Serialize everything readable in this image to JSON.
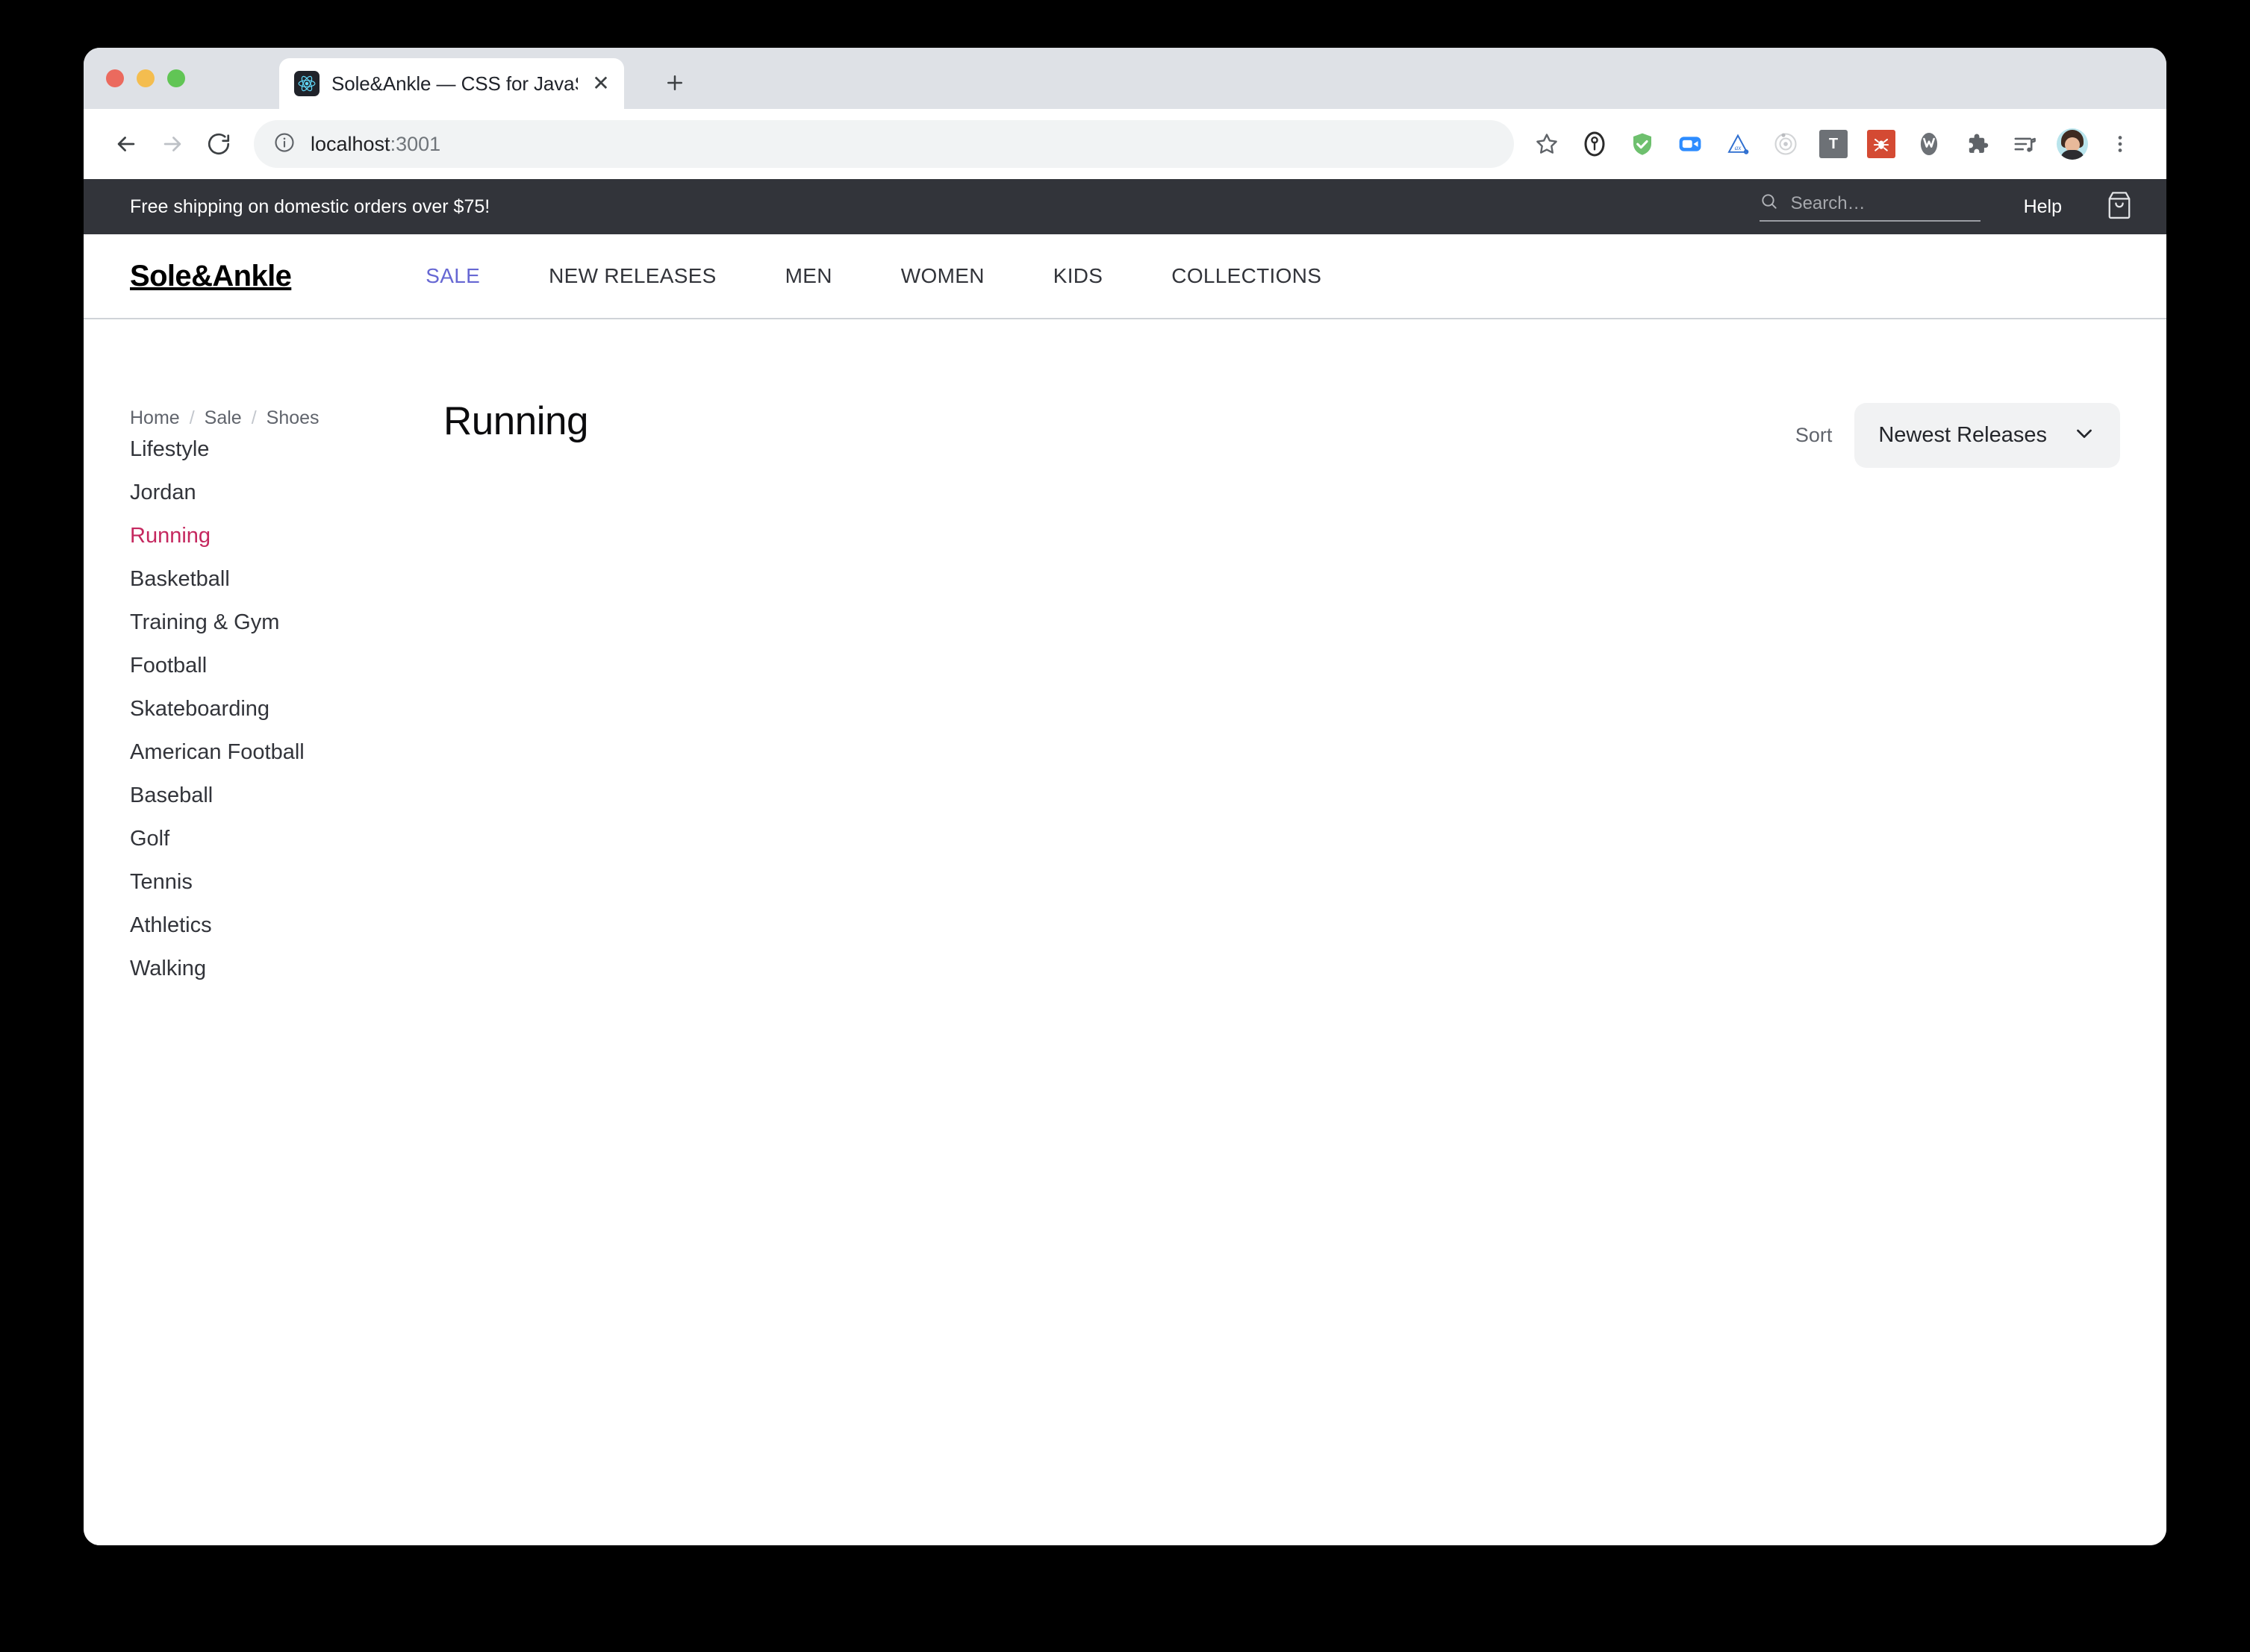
{
  "browser": {
    "tab": {
      "title": "Sole&Ankle — CSS for JavaScr",
      "favicon": "react-logo-icon",
      "close_label": "✕"
    },
    "new_tab_label": "+",
    "omnibox": {
      "host": "localhost",
      "port": ":3001",
      "info_icon": "site-info-icon"
    },
    "toolbar_icons": [
      "bookmark-star-icon",
      "one-password-icon",
      "vivaldi-shield-icon",
      "zoom-video-icon",
      "mathpix-icon",
      "orbit-icon",
      "todoist-icon",
      "bugherd-icon",
      "wappalyzer-icon",
      "extensions-puzzle-icon",
      "reading-list-icon",
      "profile-avatar",
      "chrome-menu-icon"
    ]
  },
  "superheader": {
    "promo": "Free shipping on domestic orders over $75!",
    "search": {
      "placeholder": "Search…",
      "value": "",
      "icon": "search-icon"
    },
    "help_label": "Help",
    "cart_icon": "shopping-bag-icon"
  },
  "header": {
    "logo": "Sole&Ankle",
    "nav": [
      {
        "label": "SALE",
        "accent": true
      },
      {
        "label": "NEW RELEASES",
        "accent": false
      },
      {
        "label": "MEN",
        "accent": false
      },
      {
        "label": "WOMEN",
        "accent": false
      },
      {
        "label": "KIDS",
        "accent": false
      },
      {
        "label": "COLLECTIONS",
        "accent": false
      }
    ]
  },
  "breadcrumbs": [
    {
      "label": "Home"
    },
    {
      "label": "Sale"
    },
    {
      "label": "Shoes"
    }
  ],
  "breadcrumb_separator": "/",
  "main": {
    "title": "Running",
    "sort": {
      "label": "Sort",
      "selected": "Newest Releases",
      "chevron_icon": "chevron-down-icon"
    }
  },
  "sidebar": {
    "items": [
      {
        "label": "Lifestyle",
        "active": false
      },
      {
        "label": "Jordan",
        "active": false
      },
      {
        "label": "Running",
        "active": true
      },
      {
        "label": "Basketball",
        "active": false
      },
      {
        "label": "Training & Gym",
        "active": false
      },
      {
        "label": "Football",
        "active": false
      },
      {
        "label": "Skateboarding",
        "active": false
      },
      {
        "label": "American Football",
        "active": false
      },
      {
        "label": "Baseball",
        "active": false
      },
      {
        "label": "Golf",
        "active": false
      },
      {
        "label": "Tennis",
        "active": false
      },
      {
        "label": "Athletics",
        "active": false
      },
      {
        "label": "Walking",
        "active": false
      }
    ]
  },
  "colors": {
    "accent_sale": "#6667d3",
    "accent_active": "#c5285f",
    "superheader_bg": "#32343a",
    "select_bg": "#f1f2f3"
  }
}
